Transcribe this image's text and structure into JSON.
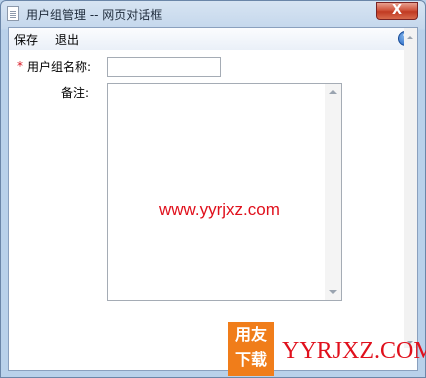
{
  "window": {
    "title": "用户组管理 -- 网页对话框",
    "close_glyph": "X"
  },
  "menu": {
    "save_label": "保存",
    "exit_label": "退出",
    "help_glyph": "?"
  },
  "form": {
    "required_marker": "*",
    "group_name_label": "用户组名称:",
    "group_name_value": "",
    "remark_label": "备注:",
    "remark_value": ""
  },
  "watermark": {
    "url": "www.yyrjxz.com",
    "logo_badge": [
      "用友",
      "下载"
    ],
    "logo_text": "YYRJXZ.COM",
    "color": "#e0101c",
    "badge_color": "#f07d1a"
  },
  "icons": {
    "title": "document-icon",
    "help": "help-icon"
  }
}
